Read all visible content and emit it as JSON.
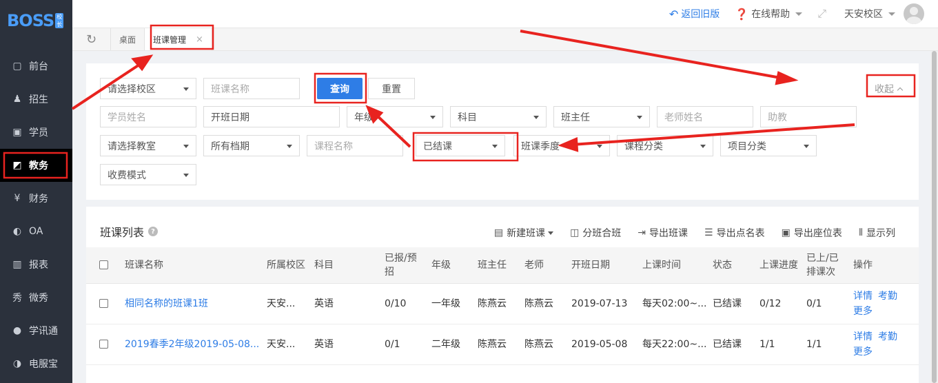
{
  "logo": {
    "text": "BOSS",
    "badge": "校长"
  },
  "sidebar": {
    "items": [
      {
        "label": "前台",
        "icon": "calendar-icon",
        "glyph": "▢"
      },
      {
        "label": "招生",
        "icon": "user-plus-icon",
        "glyph": "♟"
      },
      {
        "label": "学员",
        "icon": "id-card-icon",
        "glyph": "▣"
      },
      {
        "label": "教务",
        "icon": "board-icon",
        "glyph": "◩"
      },
      {
        "label": "财务",
        "icon": "yen-icon",
        "glyph": "¥"
      },
      {
        "label": "OA",
        "icon": "toggle-icon",
        "glyph": "◐"
      },
      {
        "label": "报表",
        "icon": "bar-chart-icon",
        "glyph": "▥"
      },
      {
        "label": "微秀",
        "icon": "xiu-icon",
        "glyph": "秀"
      },
      {
        "label": "学讯通",
        "icon": "location-icon",
        "glyph": "●"
      },
      {
        "label": "电服宝",
        "icon": "phone-icon",
        "glyph": "◑"
      }
    ],
    "active_index": 3
  },
  "topbar": {
    "back": "返回旧版",
    "help": "在线帮助",
    "campus": "天安校区"
  },
  "tabs": [
    {
      "label": "桌面"
    },
    {
      "label": "班课管理",
      "close": "×"
    }
  ],
  "filters": {
    "campus": "请选择校区",
    "class_name": "班课名称",
    "query": "查询",
    "reset": "重置",
    "collapse": "收起",
    "student_name": "学员姓名",
    "open_date": "开班日期",
    "grade": "年级",
    "subject": "科目",
    "head_teacher": "班主任",
    "teacher_name": "老师姓名",
    "assistant": "助教",
    "classroom": "请选择教室",
    "period": "所有档期",
    "course_name": "课程名称",
    "status": "已结课",
    "season": "班课季度",
    "course_category": "课程分类",
    "project_category": "项目分类",
    "charge_mode": "收费模式"
  },
  "list": {
    "title": "班课列表",
    "help_glyph": "?",
    "tools": {
      "new": "新建班课",
      "split": "分班合班",
      "export": "导出班课",
      "export_roll": "导出点名表",
      "export_seat": "导出座位表",
      "columns": "显示列"
    },
    "headers": {
      "name": "班课名称",
      "campus": "所属校区",
      "subject": "科目",
      "enrolled": "已报/预招",
      "grade": "年级",
      "head": "班主任",
      "teacher": "老师",
      "open_date": "开班日期",
      "time": "上课时间",
      "status": "状态",
      "progress": "上课进度",
      "scheduled": "已上/已排课次",
      "ops": "操作"
    },
    "rows": [
      {
        "name": "相同名称的班课1班",
        "campus": "天安...",
        "subject": "英语",
        "enrolled": "0/10",
        "grade": "一年级",
        "head": "陈燕云",
        "teacher": "陈燕云",
        "open_date": "2019-07-13",
        "time": "每天02:00~...",
        "status": "已结课",
        "progress": "0/12",
        "scheduled": "0/1",
        "op1": "详情",
        "op2": "考勤",
        "op3": "更多"
      },
      {
        "name": "2019春季2年级2019-05-08...",
        "campus": "天安...",
        "subject": "英语",
        "enrolled": "0/1",
        "grade": "二年级",
        "head": "陈燕云",
        "teacher": "陈燕云",
        "open_date": "2019-05-08",
        "time": "每天22:00~...",
        "status": "已结课",
        "progress": "1/1",
        "scheduled": "1/1",
        "op1": "详情",
        "op2": "考勤",
        "op3": "更多"
      }
    ]
  },
  "colors": {
    "accent": "#2e7de6",
    "sidebar": "#2b313c",
    "annotation": "#e8231f"
  }
}
